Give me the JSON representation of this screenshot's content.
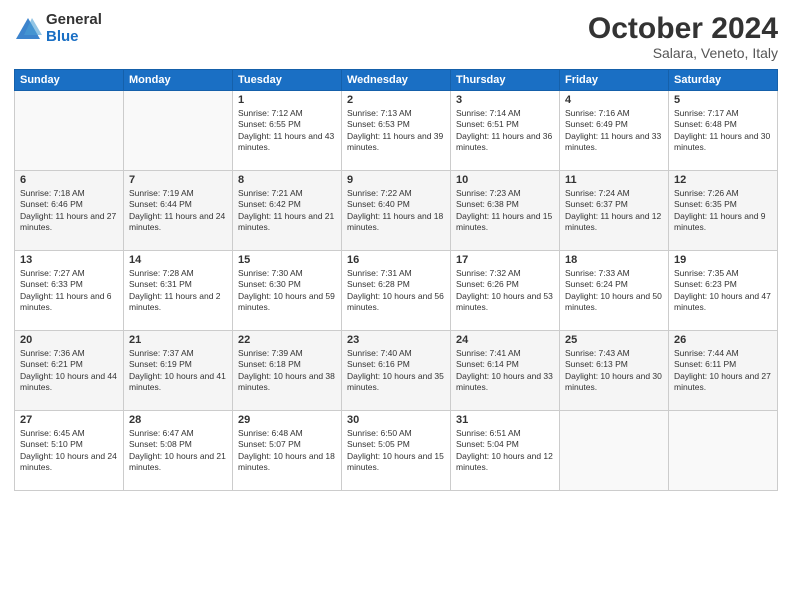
{
  "logo": {
    "general": "General",
    "blue": "Blue"
  },
  "title": "October 2024",
  "subtitle": "Salara, Veneto, Italy",
  "days_of_week": [
    "Sunday",
    "Monday",
    "Tuesday",
    "Wednesday",
    "Thursday",
    "Friday",
    "Saturday"
  ],
  "weeks": [
    [
      {
        "day": "",
        "sunrise": "",
        "sunset": "",
        "daylight": ""
      },
      {
        "day": "",
        "sunrise": "",
        "sunset": "",
        "daylight": ""
      },
      {
        "day": "1",
        "sunrise": "Sunrise: 7:12 AM",
        "sunset": "Sunset: 6:55 PM",
        "daylight": "Daylight: 11 hours and 43 minutes."
      },
      {
        "day": "2",
        "sunrise": "Sunrise: 7:13 AM",
        "sunset": "Sunset: 6:53 PM",
        "daylight": "Daylight: 11 hours and 39 minutes."
      },
      {
        "day": "3",
        "sunrise": "Sunrise: 7:14 AM",
        "sunset": "Sunset: 6:51 PM",
        "daylight": "Daylight: 11 hours and 36 minutes."
      },
      {
        "day": "4",
        "sunrise": "Sunrise: 7:16 AM",
        "sunset": "Sunset: 6:49 PM",
        "daylight": "Daylight: 11 hours and 33 minutes."
      },
      {
        "day": "5",
        "sunrise": "Sunrise: 7:17 AM",
        "sunset": "Sunset: 6:48 PM",
        "daylight": "Daylight: 11 hours and 30 minutes."
      }
    ],
    [
      {
        "day": "6",
        "sunrise": "Sunrise: 7:18 AM",
        "sunset": "Sunset: 6:46 PM",
        "daylight": "Daylight: 11 hours and 27 minutes."
      },
      {
        "day": "7",
        "sunrise": "Sunrise: 7:19 AM",
        "sunset": "Sunset: 6:44 PM",
        "daylight": "Daylight: 11 hours and 24 minutes."
      },
      {
        "day": "8",
        "sunrise": "Sunrise: 7:21 AM",
        "sunset": "Sunset: 6:42 PM",
        "daylight": "Daylight: 11 hours and 21 minutes."
      },
      {
        "day": "9",
        "sunrise": "Sunrise: 7:22 AM",
        "sunset": "Sunset: 6:40 PM",
        "daylight": "Daylight: 11 hours and 18 minutes."
      },
      {
        "day": "10",
        "sunrise": "Sunrise: 7:23 AM",
        "sunset": "Sunset: 6:38 PM",
        "daylight": "Daylight: 11 hours and 15 minutes."
      },
      {
        "day": "11",
        "sunrise": "Sunrise: 7:24 AM",
        "sunset": "Sunset: 6:37 PM",
        "daylight": "Daylight: 11 hours and 12 minutes."
      },
      {
        "day": "12",
        "sunrise": "Sunrise: 7:26 AM",
        "sunset": "Sunset: 6:35 PM",
        "daylight": "Daylight: 11 hours and 9 minutes."
      }
    ],
    [
      {
        "day": "13",
        "sunrise": "Sunrise: 7:27 AM",
        "sunset": "Sunset: 6:33 PM",
        "daylight": "Daylight: 11 hours and 6 minutes."
      },
      {
        "day": "14",
        "sunrise": "Sunrise: 7:28 AM",
        "sunset": "Sunset: 6:31 PM",
        "daylight": "Daylight: 11 hours and 2 minutes."
      },
      {
        "day": "15",
        "sunrise": "Sunrise: 7:30 AM",
        "sunset": "Sunset: 6:30 PM",
        "daylight": "Daylight: 10 hours and 59 minutes."
      },
      {
        "day": "16",
        "sunrise": "Sunrise: 7:31 AM",
        "sunset": "Sunset: 6:28 PM",
        "daylight": "Daylight: 10 hours and 56 minutes."
      },
      {
        "day": "17",
        "sunrise": "Sunrise: 7:32 AM",
        "sunset": "Sunset: 6:26 PM",
        "daylight": "Daylight: 10 hours and 53 minutes."
      },
      {
        "day": "18",
        "sunrise": "Sunrise: 7:33 AM",
        "sunset": "Sunset: 6:24 PM",
        "daylight": "Daylight: 10 hours and 50 minutes."
      },
      {
        "day": "19",
        "sunrise": "Sunrise: 7:35 AM",
        "sunset": "Sunset: 6:23 PM",
        "daylight": "Daylight: 10 hours and 47 minutes."
      }
    ],
    [
      {
        "day": "20",
        "sunrise": "Sunrise: 7:36 AM",
        "sunset": "Sunset: 6:21 PM",
        "daylight": "Daylight: 10 hours and 44 minutes."
      },
      {
        "day": "21",
        "sunrise": "Sunrise: 7:37 AM",
        "sunset": "Sunset: 6:19 PM",
        "daylight": "Daylight: 10 hours and 41 minutes."
      },
      {
        "day": "22",
        "sunrise": "Sunrise: 7:39 AM",
        "sunset": "Sunset: 6:18 PM",
        "daylight": "Daylight: 10 hours and 38 minutes."
      },
      {
        "day": "23",
        "sunrise": "Sunrise: 7:40 AM",
        "sunset": "Sunset: 6:16 PM",
        "daylight": "Daylight: 10 hours and 35 minutes."
      },
      {
        "day": "24",
        "sunrise": "Sunrise: 7:41 AM",
        "sunset": "Sunset: 6:14 PM",
        "daylight": "Daylight: 10 hours and 33 minutes."
      },
      {
        "day": "25",
        "sunrise": "Sunrise: 7:43 AM",
        "sunset": "Sunset: 6:13 PM",
        "daylight": "Daylight: 10 hours and 30 minutes."
      },
      {
        "day": "26",
        "sunrise": "Sunrise: 7:44 AM",
        "sunset": "Sunset: 6:11 PM",
        "daylight": "Daylight: 10 hours and 27 minutes."
      }
    ],
    [
      {
        "day": "27",
        "sunrise": "Sunrise: 6:45 AM",
        "sunset": "Sunset: 5:10 PM",
        "daylight": "Daylight: 10 hours and 24 minutes."
      },
      {
        "day": "28",
        "sunrise": "Sunrise: 6:47 AM",
        "sunset": "Sunset: 5:08 PM",
        "daylight": "Daylight: 10 hours and 21 minutes."
      },
      {
        "day": "29",
        "sunrise": "Sunrise: 6:48 AM",
        "sunset": "Sunset: 5:07 PM",
        "daylight": "Daylight: 10 hours and 18 minutes."
      },
      {
        "day": "30",
        "sunrise": "Sunrise: 6:50 AM",
        "sunset": "Sunset: 5:05 PM",
        "daylight": "Daylight: 10 hours and 15 minutes."
      },
      {
        "day": "31",
        "sunrise": "Sunrise: 6:51 AM",
        "sunset": "Sunset: 5:04 PM",
        "daylight": "Daylight: 10 hours and 12 minutes."
      },
      {
        "day": "",
        "sunrise": "",
        "sunset": "",
        "daylight": ""
      },
      {
        "day": "",
        "sunrise": "",
        "sunset": "",
        "daylight": ""
      }
    ]
  ]
}
